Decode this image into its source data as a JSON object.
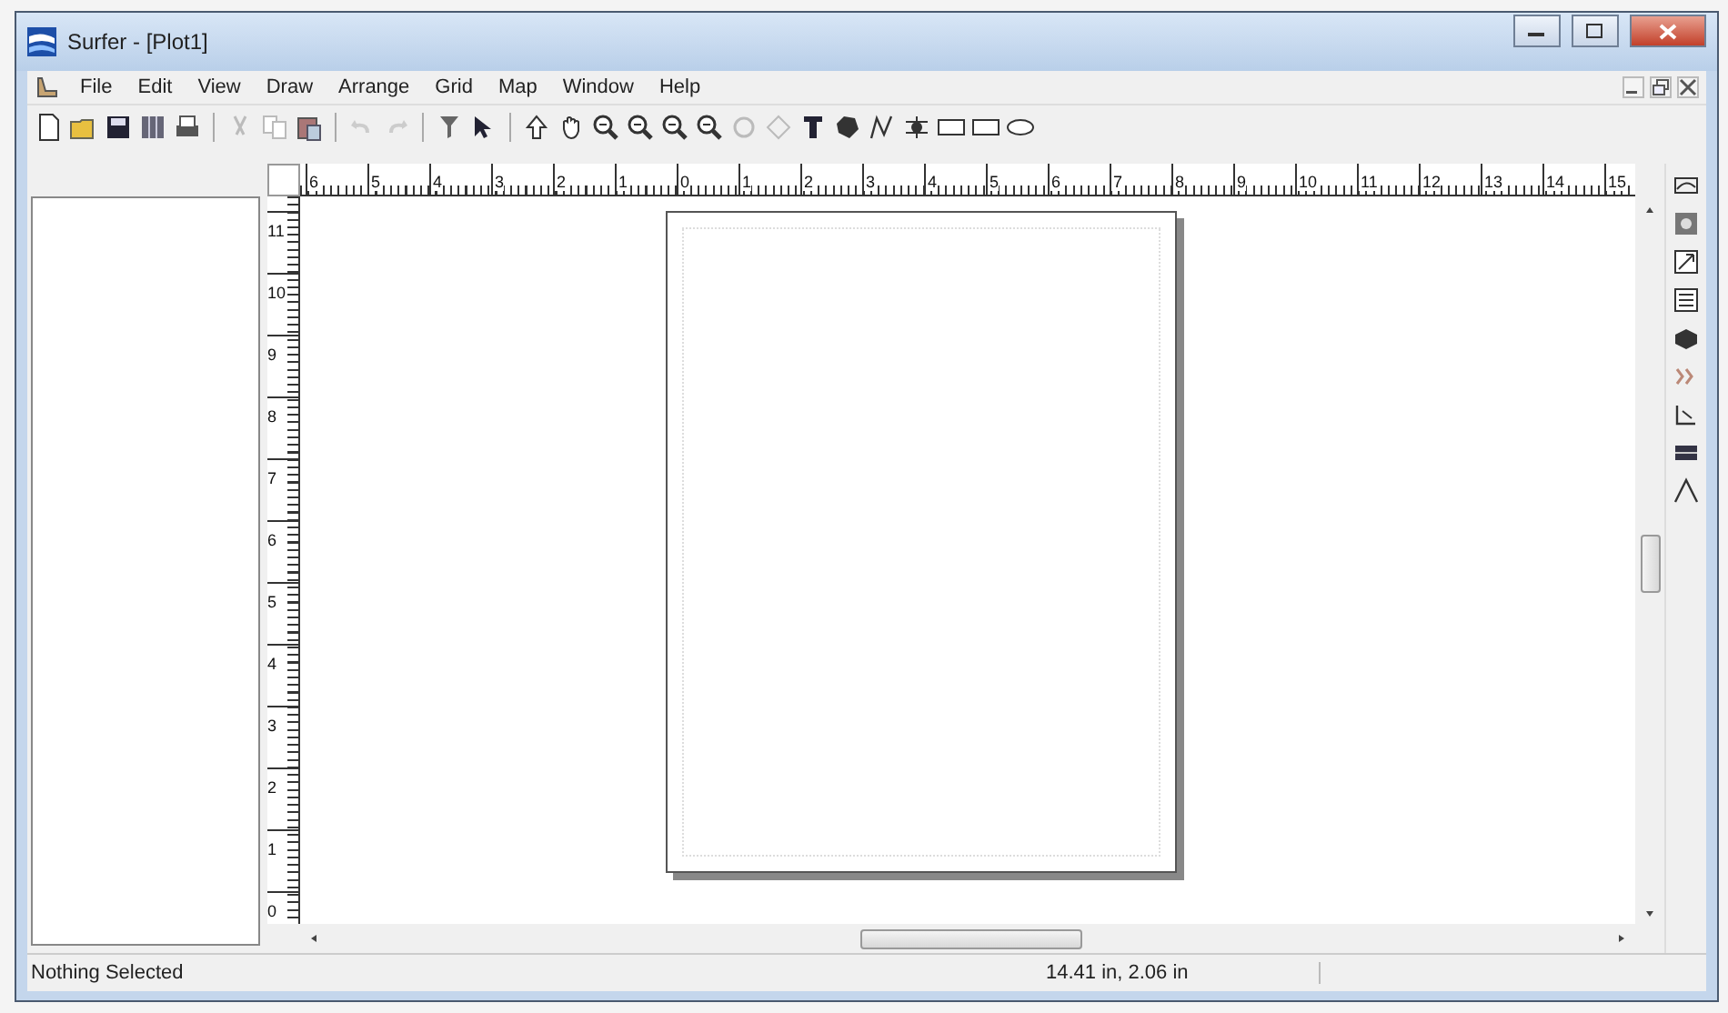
{
  "window": {
    "title": "Surfer - [Plot1]"
  },
  "menu": [
    "File",
    "Edit",
    "View",
    "Draw",
    "Arrange",
    "Grid",
    "Map",
    "Window",
    "Help"
  ],
  "ruler_horizontal": [
    "6",
    "5",
    "4",
    "3",
    "2",
    "1",
    "0",
    "1",
    "2",
    "3",
    "4",
    "5",
    "6",
    "7",
    "8",
    "9",
    "10",
    "11",
    "12",
    "13",
    "14",
    "15"
  ],
  "ruler_vertical": [
    "11",
    "10",
    "9",
    "8",
    "7",
    "6",
    "5",
    "4",
    "3",
    "2",
    "1",
    "0"
  ],
  "status_bar": {
    "message": "Nothing Selected",
    "position": "14.41 in, 2.06 in"
  }
}
